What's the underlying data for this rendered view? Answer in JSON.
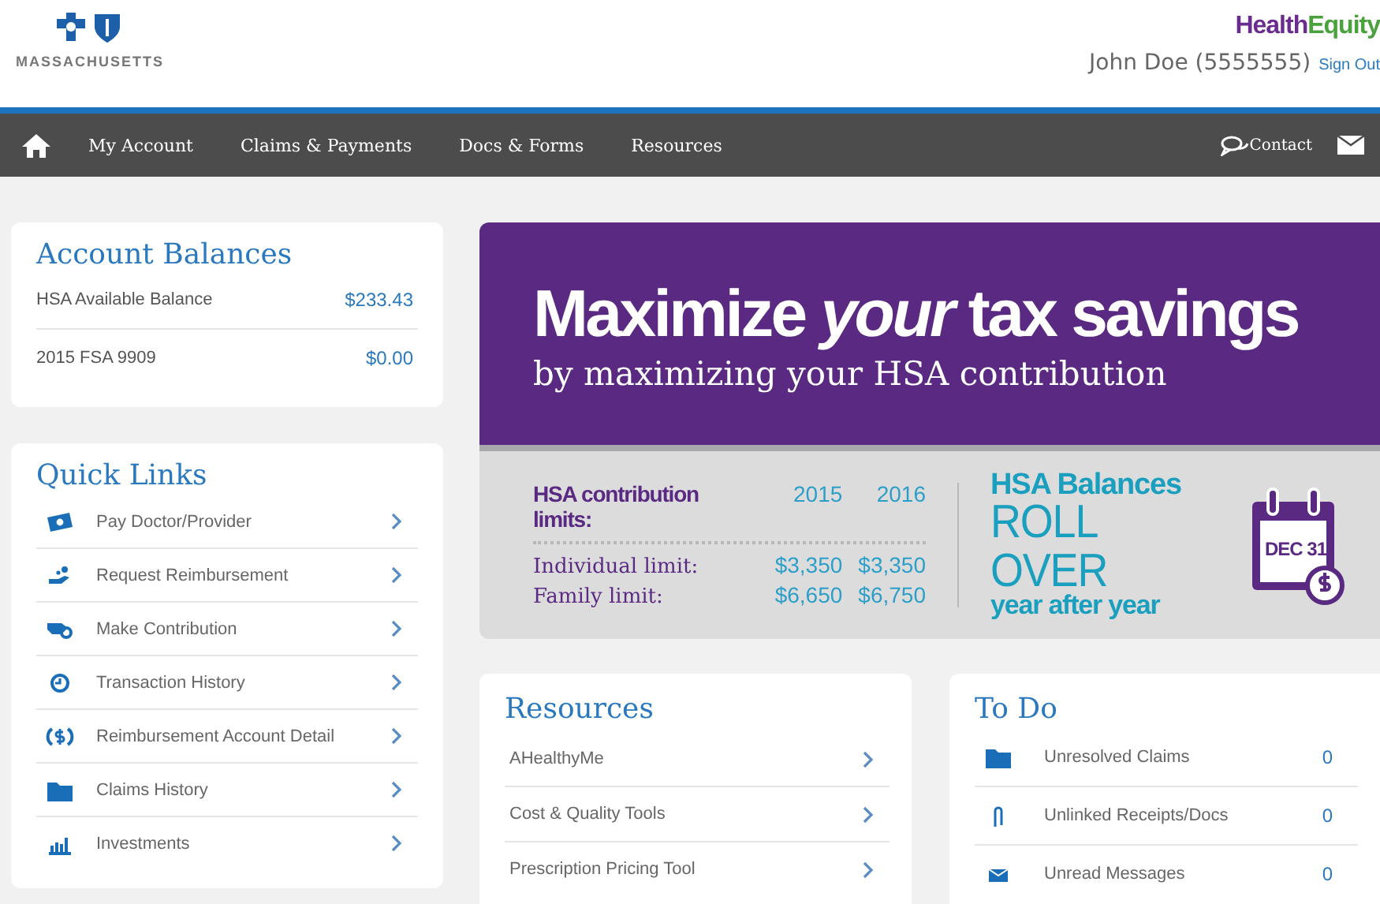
{
  "header": {
    "logo_text": "MASSACHUSETTS",
    "brand": {
      "part1": "Health",
      "part2": "Equity"
    },
    "user": "John Doe (5555555)",
    "sign_out": "Sign Out"
  },
  "nav": {
    "items": [
      "My Account",
      "Claims & Payments",
      "Docs & Forms",
      "Resources"
    ],
    "contact": "Contact"
  },
  "account_balances": {
    "title": "Account Balances",
    "rows": [
      {
        "label": "HSA Available Balance",
        "value": "$233.43"
      },
      {
        "label": "2015 FSA 9909",
        "value": "$0.00"
      }
    ]
  },
  "quick_links": {
    "title": "Quick Links",
    "items": [
      {
        "label": "Pay Doctor/Provider"
      },
      {
        "label": "Request Reimbursement"
      },
      {
        "label": "Make Contribution"
      },
      {
        "label": "Transaction History"
      },
      {
        "label": "Reimbursement Account Detail"
      },
      {
        "label": "Claims History"
      },
      {
        "label": "Investments"
      }
    ]
  },
  "banner": {
    "headline": "Maximize *your* tax savings",
    "subline": "by maximizing your HSA contribution",
    "limits_title": "HSA contribution limits:",
    "years": [
      "2015",
      "2016"
    ],
    "limits": [
      {
        "label": "Individual limit:",
        "values": [
          "$3,350",
          "$3,350"
        ]
      },
      {
        "label": "Family limit:",
        "values": [
          "$6,650",
          "$6,750"
        ]
      }
    ],
    "rollover": [
      "HSA Balances",
      "ROLL OVER",
      "year after year"
    ],
    "calendar_date": "DEC 31"
  },
  "resources": {
    "title": "Resources",
    "items": [
      "AHealthyMe",
      "Cost & Quality Tools",
      "Prescription Pricing Tool"
    ]
  },
  "todo": {
    "title": "To Do",
    "items": [
      {
        "label": "Unresolved Claims",
        "count": "0"
      },
      {
        "label": "Unlinked Receipts/Docs",
        "count": "0"
      },
      {
        "label": "Unread Messages",
        "count": "0"
      }
    ]
  }
}
